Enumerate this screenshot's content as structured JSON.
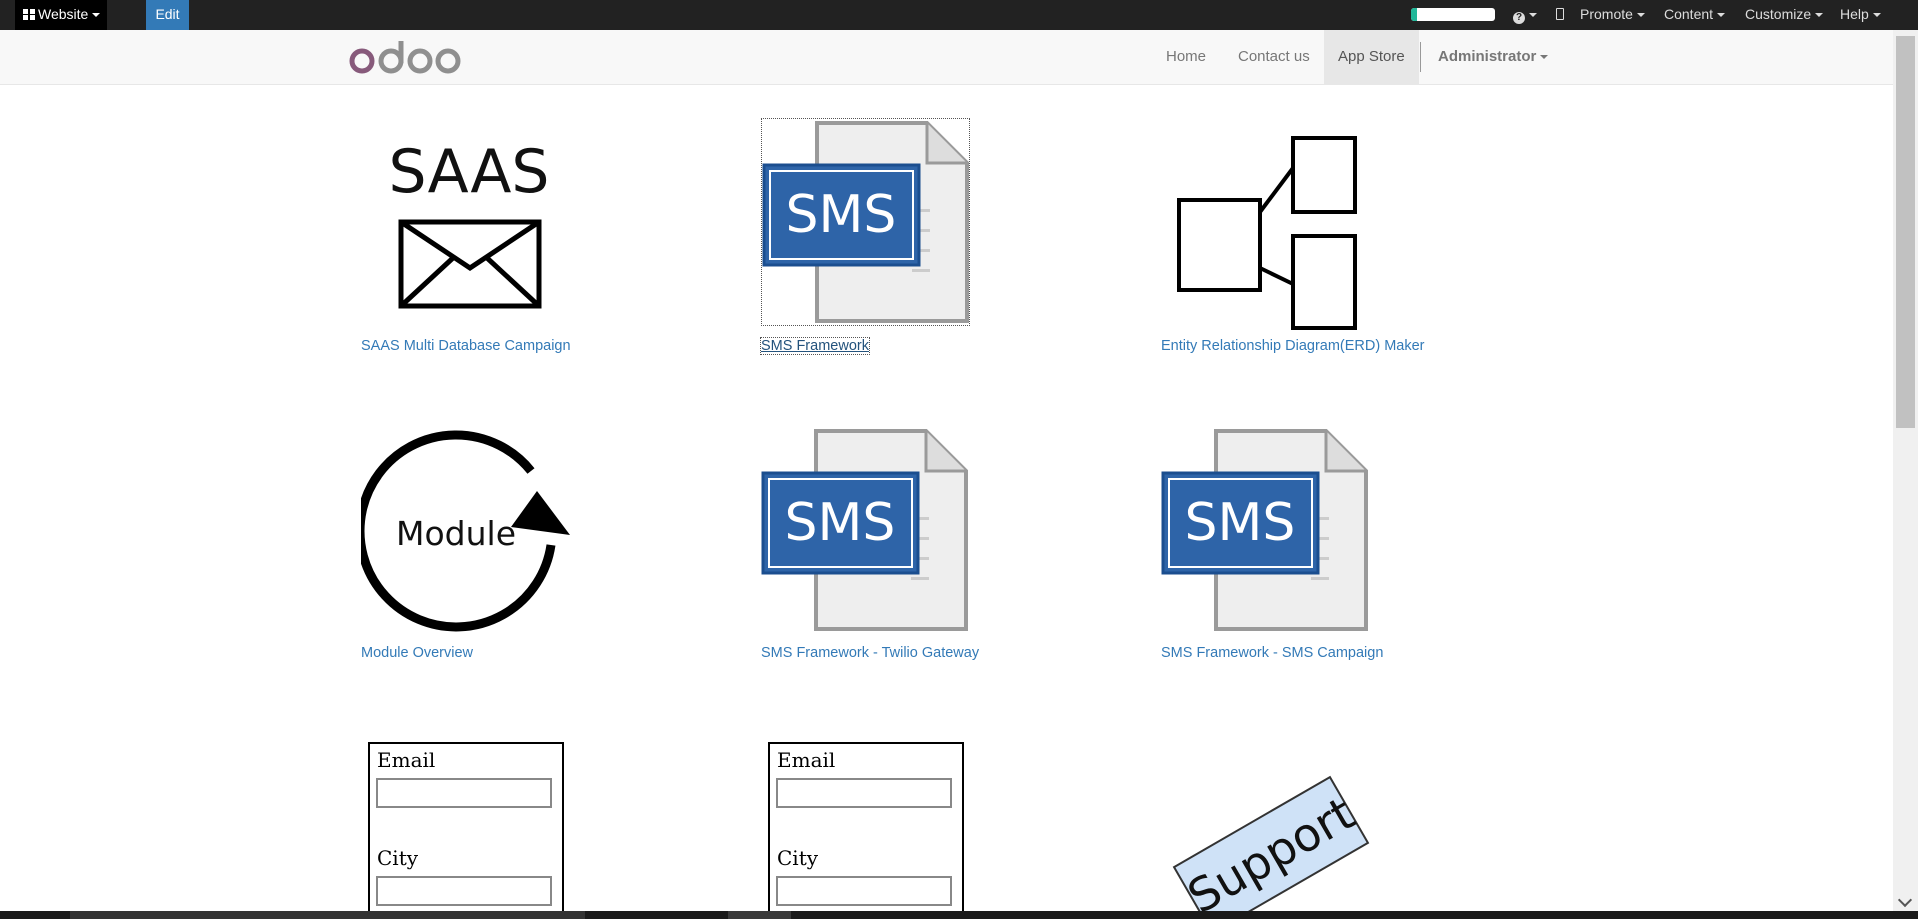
{
  "topbar": {
    "website_label": "Website",
    "edit_label": "Edit",
    "promote_label": "Promote",
    "content_label": "Content",
    "customize_label": "Customize",
    "help_label": "Help"
  },
  "navbar": {
    "logo_text": "odoo",
    "home": "Home",
    "contact": "Contact us",
    "app_store": "App Store",
    "user": "Administrator"
  },
  "modules": [
    {
      "name": "SAAS Multi Database Campaign",
      "icon": "saas-envelope-icon"
    },
    {
      "name": "SMS Framework",
      "icon": "sms-document-icon"
    },
    {
      "name": "Entity Relationship Diagram(ERD) Maker",
      "icon": "erd-diagram-icon"
    },
    {
      "name": "Module Overview",
      "icon": "module-cycle-icon"
    },
    {
      "name": "SMS Framework - Twilio Gateway",
      "icon": "sms-document-icon"
    },
    {
      "name": "SMS Framework - SMS Campaign",
      "icon": "sms-document-icon"
    },
    {
      "name": "",
      "icon": "form-fields-icon"
    },
    {
      "name": "",
      "icon": "form-fields-icon"
    },
    {
      "name": "",
      "icon": "support-tag-icon"
    }
  ],
  "thumb_text": {
    "saas": "SAAS",
    "sms": "SMS",
    "module": "Module",
    "email": "Email",
    "city": "City",
    "support": "Support"
  },
  "colors": {
    "topbar_bg": "#222222",
    "edit_bg": "#337ab7",
    "link": "#337ab7",
    "sms_blue": "#2e64a8"
  }
}
